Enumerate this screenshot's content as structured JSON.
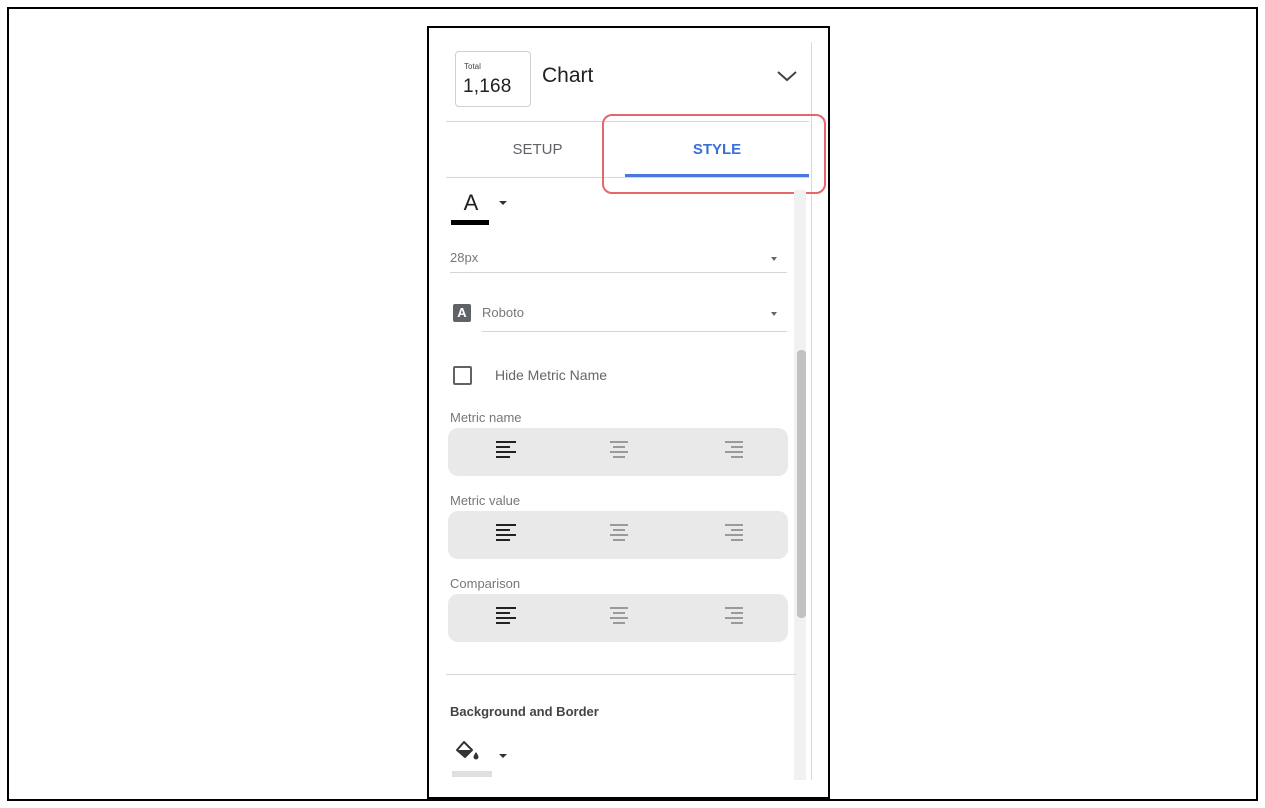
{
  "chart_header": {
    "icon_total_label": "Total",
    "icon_value": "1,168",
    "title": "Chart"
  },
  "tabs": [
    {
      "label": "SETUP",
      "active": false
    },
    {
      "label": "STYLE",
      "active": true
    }
  ],
  "style": {
    "font_color_glyph": "A",
    "font_size": {
      "value": "28px"
    },
    "font_family": {
      "badge": "A",
      "value": "Roboto"
    },
    "hide_metric_name": {
      "label": "Hide Metric Name",
      "checked": false
    },
    "alignment_groups": [
      {
        "label": "Metric name",
        "options": [
          "left",
          "center",
          "right"
        ],
        "selected": "left"
      },
      {
        "label": "Metric value",
        "options": [
          "left",
          "center",
          "right"
        ],
        "selected": "left"
      },
      {
        "label": "Comparison",
        "options": [
          "left",
          "center",
          "right"
        ],
        "selected": "left"
      }
    ],
    "background_and_border": {
      "title": "Background and Border"
    }
  },
  "colors": {
    "accent": "#4a78e0",
    "highlight": "#e5676d",
    "font_color": "#000000"
  },
  "icons": [
    "chevron-down-icon",
    "font-color-icon",
    "dropdown-caret-icon",
    "text-align-left-icon",
    "text-align-center-icon",
    "text-align-right-icon",
    "fill-color-icon"
  ]
}
